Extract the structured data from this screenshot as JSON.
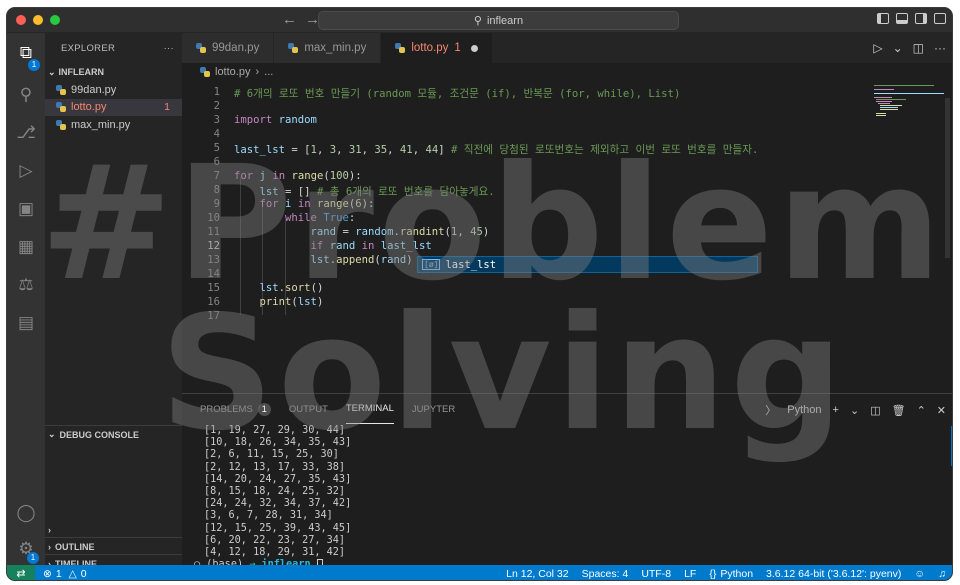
{
  "window": {
    "search": "inflearn",
    "traffic_colors": [
      "#ff5f57",
      "#febc2e",
      "#28c840"
    ]
  },
  "activity_bar": {
    "explorer_badge": "1",
    "manage_badge": "1"
  },
  "sidebar": {
    "title": "EXPLORER",
    "more": "···",
    "folder": "INFLEARN",
    "files": [
      {
        "name": "99dan.py",
        "error": false
      },
      {
        "name": "lotto.py",
        "error": true,
        "problems": "1"
      },
      {
        "name": "max_min.py",
        "error": false
      }
    ],
    "debug_console": "DEBUG CONSOLE",
    "outline": "OUTLINE",
    "timeline": "TIMELINE"
  },
  "tabs": [
    {
      "label": "99dan.py"
    },
    {
      "label": "max_min.py"
    },
    {
      "label": "lotto.py",
      "problems": "1",
      "active": true
    }
  ],
  "breadcrumb": {
    "file": "lotto.py",
    "rest": "..."
  },
  "editor": {
    "current_line": 12,
    "suggestion": "last_lst",
    "line_numbers": [
      "1",
      "2",
      "3",
      "4",
      "5",
      "6",
      "7",
      "8",
      "9",
      "10",
      "11",
      "12",
      "13",
      "14",
      "15",
      "16",
      "17"
    ]
  },
  "panel": {
    "tabs": [
      "PROBLEMS",
      "OUTPUT",
      "TERMINAL",
      "JUPYTER"
    ],
    "problems_count": "1",
    "active_tab": "TERMINAL",
    "shell": "Python",
    "terminal_lines": [
      "[1, 19, 27, 29, 30, 44]",
      "[10, 18, 26, 34, 35, 43]",
      "[2, 6, 11, 15, 25, 30]",
      "[2, 12, 13, 17, 33, 38]",
      "[14, 20, 24, 27, 35, 43]",
      "[8, 15, 18, 24, 25, 32]",
      "[24, 24, 32, 34, 37, 42]",
      "[3, 6, 7, 28, 31, 34]",
      "[12, 15, 25, 39, 43, 45]",
      "[6, 20, 22, 23, 27, 34]",
      "[4, 12, 18, 29, 31, 42]"
    ],
    "prompt_env": "(base)",
    "prompt_arrow": "→",
    "prompt_dir": "inflearn"
  },
  "statusbar": {
    "errors": "1",
    "warnings": "0",
    "position": "Ln 12, Col 32",
    "spaces": "Spaces: 4",
    "encoding": "UTF-8",
    "eol": "LF",
    "language": "Python",
    "interpreter": "3.6.12 64-bit ('3.6.12': pyenv)"
  },
  "overlay": {
    "line1": "#Problem",
    "line2": "Solving"
  }
}
